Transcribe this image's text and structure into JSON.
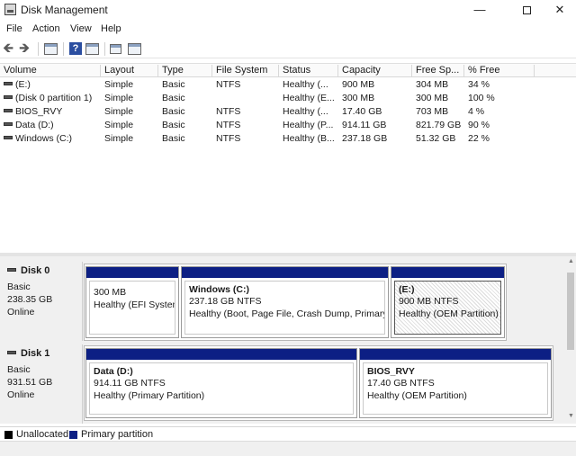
{
  "window": {
    "title": "Disk Management",
    "min_glyph": "—",
    "close_glyph": "✕"
  },
  "menu": [
    "File",
    "Action",
    "View",
    "Help"
  ],
  "toolbar": {
    "back_glyph": "🡸",
    "forward_glyph": "🡺",
    "help_glyph": "?",
    "icons": [
      "back-icon",
      "forward-icon",
      "properties-icon",
      "help-icon",
      "console-icon",
      "connect-icon",
      "list-view-icon"
    ]
  },
  "columns": [
    "Volume",
    "Layout",
    "Type",
    "File System",
    "Status",
    "Capacity",
    "Free Sp...",
    "% Free"
  ],
  "volumes": [
    {
      "volume": "(E:)",
      "layout": "Simple",
      "type": "Basic",
      "fs": "NTFS",
      "status": "Healthy (...",
      "capacity": "900 MB",
      "free": "304 MB",
      "pct": "34 %"
    },
    {
      "volume": "(Disk 0 partition 1)",
      "layout": "Simple",
      "type": "Basic",
      "fs": "",
      "status": "Healthy (E...",
      "capacity": "300 MB",
      "free": "300 MB",
      "pct": "100 %"
    },
    {
      "volume": "BIOS_RVY",
      "layout": "Simple",
      "type": "Basic",
      "fs": "NTFS",
      "status": "Healthy (...",
      "capacity": "17.40 GB",
      "free": "703 MB",
      "pct": "4 %"
    },
    {
      "volume": "Data (D:)",
      "layout": "Simple",
      "type": "Basic",
      "fs": "NTFS",
      "status": "Healthy (P...",
      "capacity": "914.11 GB",
      "free": "821.79 GB",
      "pct": "90 %"
    },
    {
      "volume": "Windows (C:)",
      "layout": "Simple",
      "type": "Basic",
      "fs": "NTFS",
      "status": "Healthy (B...",
      "capacity": "237.18 GB",
      "free": "51.32 GB",
      "pct": "22 %"
    }
  ],
  "disks": [
    {
      "name": "Disk 0",
      "type": "Basic",
      "size": "238.35 GB",
      "state": "Online",
      "partitions": [
        {
          "title": "",
          "size": "300 MB",
          "status": "Healthy (EFI System"
        },
        {
          "title": "Windows  (C:)",
          "size": "237.18 GB NTFS",
          "status": "Healthy (Boot, Page File, Crash Dump, Primary P"
        },
        {
          "title": "(E:)",
          "size": "900 MB NTFS",
          "status": "Healthy (OEM Partition)"
        }
      ]
    },
    {
      "name": "Disk 1",
      "type": "Basic",
      "size": "931.51 GB",
      "state": "Online",
      "partitions": [
        {
          "title": "Data  (D:)",
          "size": "914.11 GB NTFS",
          "status": "Healthy (Primary Partition)"
        },
        {
          "title": "BIOS_RVY",
          "size": "17.40 GB NTFS",
          "status": "Healthy (OEM Partition)"
        }
      ]
    }
  ],
  "legend": [
    {
      "label": "Unallocated",
      "color": "#000000"
    },
    {
      "label": "Primary partition",
      "color": "#0c1f84"
    }
  ],
  "colors": {
    "partition_bar": "#0c1f84",
    "unallocated": "#000000"
  }
}
